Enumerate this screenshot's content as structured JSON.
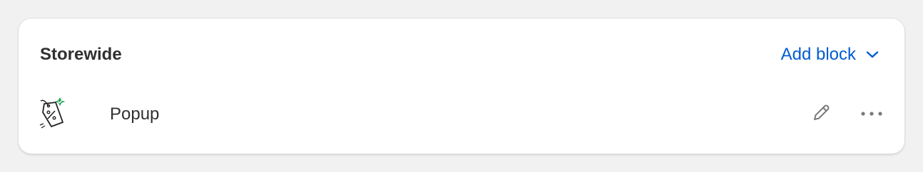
{
  "section": {
    "title": "Storewide",
    "add_block_label": "Add block"
  },
  "blocks": [
    {
      "label": "Popup",
      "icon": "discount-tag-icon"
    }
  ],
  "colors": {
    "accent": "#005bd3",
    "text": "#303030",
    "icon_muted": "#7a7a7a",
    "badge_green": "#29a35a",
    "background": "#f1f1f1"
  }
}
